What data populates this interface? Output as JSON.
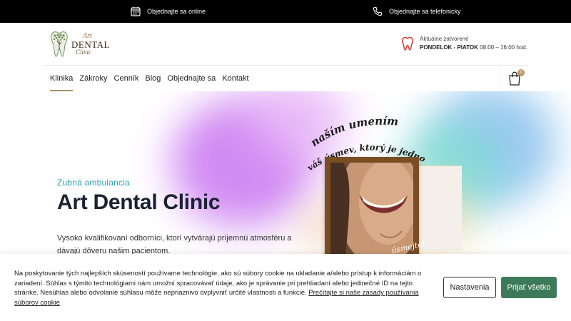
{
  "topbar": {
    "online_label": "Objednajte sa online",
    "online_icon": "calendar-icon",
    "phone_label": "Objednajte sa telefonicky",
    "phone_icon": "phone-icon"
  },
  "header": {
    "logo": {
      "line1": "Art",
      "line2": "DENTAL",
      "line3": "Clinic"
    },
    "hours": {
      "icon": "tooth-icon",
      "status": "Aktuálne zatvorené",
      "days": "PONDELOK - PIATOK",
      "time": "08:00 – 16:00 hod."
    }
  },
  "nav": {
    "items": [
      {
        "label": "Klinika"
      },
      {
        "label": "Zákroky"
      },
      {
        "label": "Cenník"
      },
      {
        "label": "Blog"
      },
      {
        "label": "Objednajte sa"
      },
      {
        "label": "Kontakt"
      }
    ],
    "cart_count": "0"
  },
  "hero": {
    "subtitle": "Zubná ambulancia",
    "title": "Art Dental Clinic",
    "description": "Vysoko kvalifikovaní odborníci, ktorí vytvárajú príjemnú atmosféru a dávajú dôveru našim pacientom.",
    "handwriting_line1": "naším umením je",
    "handwriting_line2": "váš úsmev, ktorý je jednoduchý",
    "sticker": "úsmejte!"
  },
  "cookie": {
    "text": "Na poskytovanie tých najlepších skúseností používame technológie, ako sú súbory cookie na ukladanie a/alebo prístup k informáciám o zariadení. Súhlas s týmito technológiami nám umožní spracovávať údaje, ako je správanie pri prehliadaní alebo jedinečné ID na tejto stránke. Nesúhlas alebo odvolanie súhlasu môže nepriaznivo ovplyvniť určité vlastnosti a funkcie.",
    "link": "Prečítajte si naše zásady používania súborov cookie",
    "settings_button": "Nastavenia",
    "accept_button": "Prijať všetko"
  },
  "colors": {
    "topbar_bg": "#000000",
    "accent_gold": "#a89063",
    "hero_subtitle": "#2fa0b8",
    "accept_green": "#3d7a59"
  }
}
